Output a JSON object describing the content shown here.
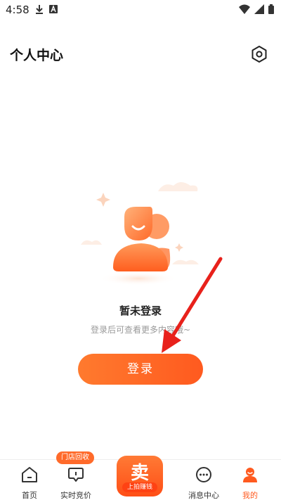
{
  "status_bar": {
    "time": "4:58",
    "icons": [
      "download-icon",
      "notification-a-icon",
      "wifi-icon",
      "signal-icon",
      "battery-icon"
    ]
  },
  "header": {
    "title": "个人中心",
    "settings_icon": "gear-icon"
  },
  "empty_state": {
    "title": "暂未登录",
    "description": "登录后可查看更多内容哦~",
    "illustration": "user-avatar-illustration"
  },
  "login_button": {
    "label": "登录"
  },
  "tabs": [
    {
      "label": "首页",
      "icon": "home-icon",
      "active": false
    },
    {
      "label": "实时竞价",
      "icon": "bid-icon",
      "active": false,
      "badge": "门店回收"
    },
    {
      "label": "消息中心",
      "icon": "message-icon",
      "active": false
    },
    {
      "label": "我的",
      "icon": "profile-icon",
      "active": true
    }
  ],
  "sell_button": {
    "main": "卖",
    "sub": "上拍赚钱"
  },
  "colors": {
    "accent": "#ff5a1f",
    "accent_light": "#ff7a2e",
    "arrow": "#e8211b"
  }
}
